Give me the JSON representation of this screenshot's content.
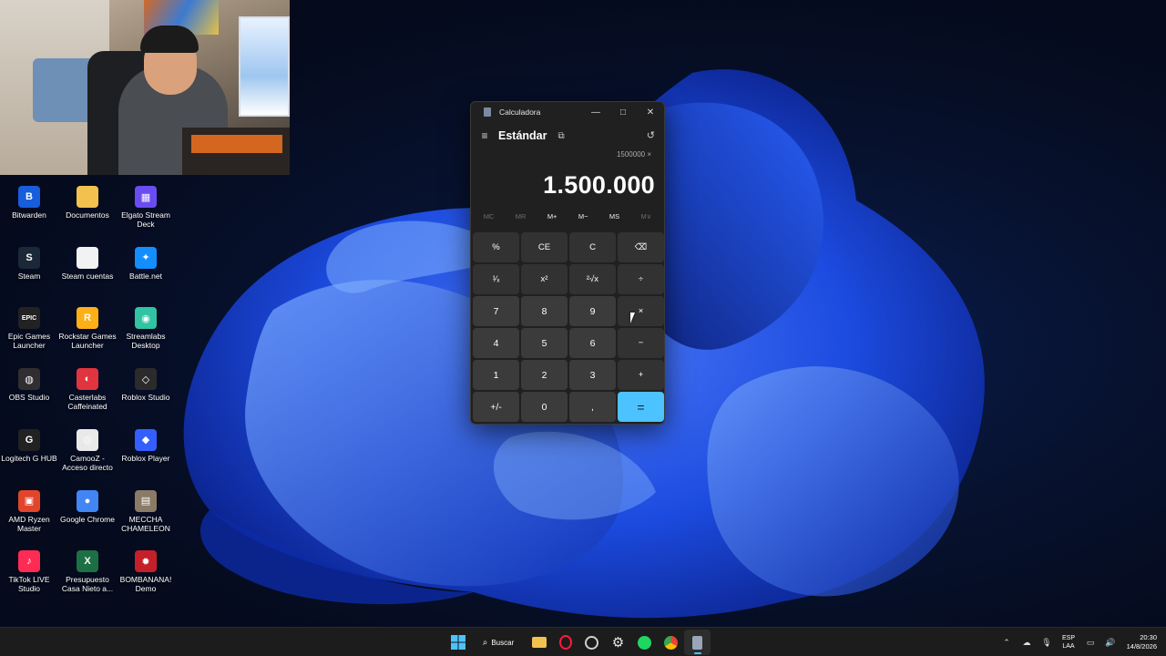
{
  "calculator": {
    "window_title": "Calculadora",
    "minimize": "—",
    "maximize": "□",
    "close": "✕",
    "menu_icon": "≡",
    "mode": "Estándar",
    "keep_on_top_icon": "⧉",
    "history_icon": "↺",
    "expression": "1500000 ×",
    "display": "1.500.000",
    "memory": [
      "MC",
      "MR",
      "M+",
      "M−",
      "MS",
      "M∨"
    ],
    "memory_disabled": [
      true,
      true,
      false,
      false,
      false,
      true
    ],
    "keys": [
      [
        "%",
        "CE",
        "C",
        "⌫"
      ],
      [
        "¹⁄ₓ",
        "x²",
        "²√x",
        "÷"
      ],
      [
        "7",
        "8",
        "9",
        "×"
      ],
      [
        "4",
        "5",
        "6",
        "−"
      ],
      [
        "1",
        "2",
        "3",
        "+"
      ],
      [
        "+/-",
        "0",
        ",",
        "="
      ]
    ]
  },
  "desktop_icons": [
    {
      "label": "Bitwarden",
      "color": "#175ddc",
      "glyph": "B"
    },
    {
      "label": "Documentos",
      "color": "#f2c14e",
      "glyph": ""
    },
    {
      "label": "Elgato Stream Deck",
      "color": "#6a4df2",
      "glyph": "▦"
    },
    {
      "label": "Steam",
      "color": "#1b2838",
      "glyph": "S"
    },
    {
      "label": "Steam cuentas",
      "color": "#f2f2f2",
      "glyph": ""
    },
    {
      "label": "Battle.net",
      "color": "#148eff",
      "glyph": "✦"
    },
    {
      "label": "Epic Games Launcher",
      "color": "#222222",
      "glyph": "EPIC"
    },
    {
      "label": "Rockstar Games Launcher",
      "color": "#fcaf17",
      "glyph": "R"
    },
    {
      "label": "Streamlabs Desktop",
      "color": "#31c3a2",
      "glyph": "◉"
    },
    {
      "label": "OBS Studio",
      "color": "#302e31",
      "glyph": "◍"
    },
    {
      "label": "Casterlabs Caffeinated",
      "color": "#e0343f",
      "glyph": "◐"
    },
    {
      "label": "Roblox Studio",
      "color": "#2b2b2b",
      "glyph": "◇"
    },
    {
      "label": "Logitech G HUB",
      "color": "#222222",
      "glyph": "G"
    },
    {
      "label": "CamooZ - Acceso directo",
      "color": "#e9e9e9",
      "glyph": "◎"
    },
    {
      "label": "Roblox Player",
      "color": "#335fff",
      "glyph": "◆"
    },
    {
      "label": "AMD Ryzen Master",
      "color": "#e2452b",
      "glyph": "▣"
    },
    {
      "label": "Google Chrome",
      "color": "#4285f4",
      "glyph": "●"
    },
    {
      "label": "MECCHA CHAMELEON",
      "color": "#8a7a66",
      "glyph": "▤"
    },
    {
      "label": "TikTok LIVE Studio",
      "color": "#fe2c55",
      "glyph": "♪"
    },
    {
      "label": "Presupuesto Casa Nieto a...",
      "color": "#1d7044",
      "glyph": "X"
    },
    {
      "label": "BOMBANANA! Demo",
      "color": "#c4202a",
      "glyph": "✹"
    }
  ],
  "taskbar": {
    "search_label": "Buscar",
    "items": [
      "windows-start",
      "search",
      "file-explorer",
      "opera-gx",
      "app-clock",
      "settings-gear",
      "spotify",
      "google-chrome",
      "calculator"
    ],
    "tray": {
      "lang_line1": "ESP",
      "lang_line2": "LAA",
      "time": "20:30",
      "date": "14/8/2026"
    }
  },
  "colors": {
    "accent": "#4cc2ff",
    "calc_bg": "#202020",
    "key_bg": "#3b3b3b"
  }
}
